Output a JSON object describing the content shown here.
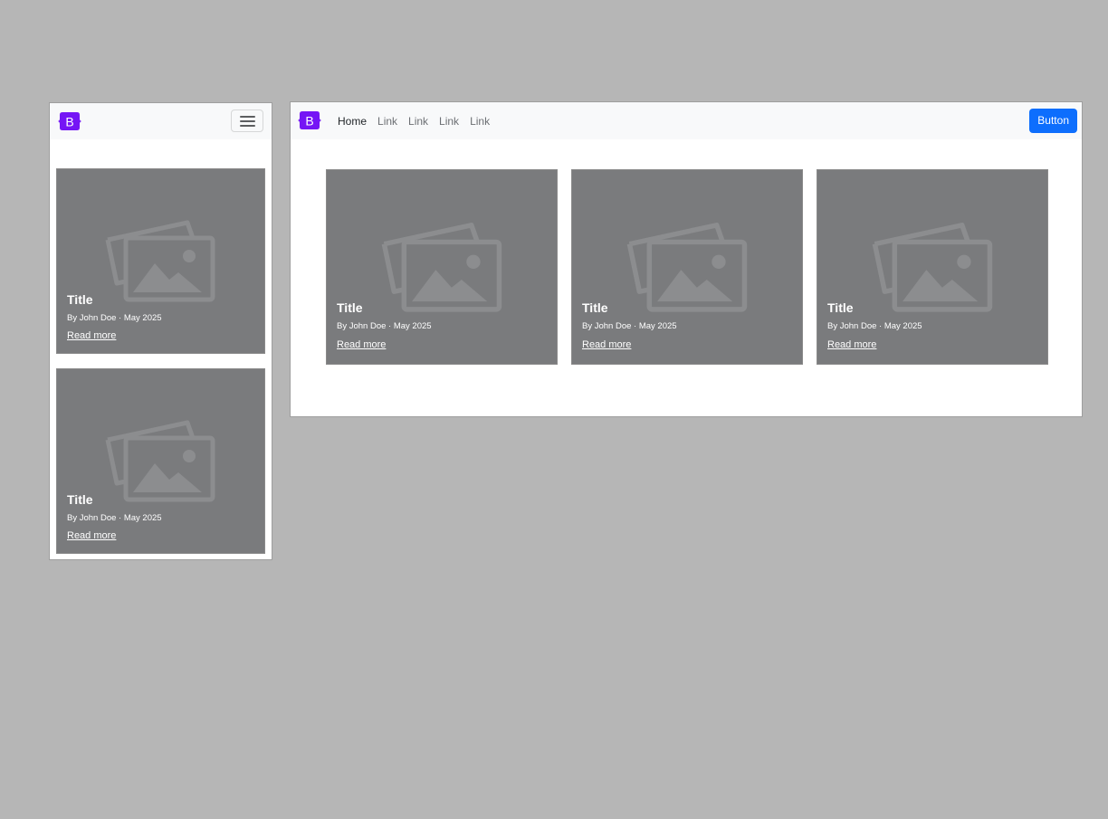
{
  "brand": {
    "logo_letter": "B",
    "logo_color": "#7515f5"
  },
  "navbar_mobile": {
    "toggler_icon": "hamburger-menu-icon"
  },
  "navbar_desktop": {
    "links": [
      "Home",
      "Link",
      "Link",
      "Link",
      "Link"
    ],
    "active_link": "Home",
    "button_label": "Button",
    "button_color": "#0d6efd"
  },
  "card_template": {
    "title": "Title",
    "meta": "By John Doe · May 2025",
    "link_label": "Read more",
    "image_icon": "image-placeholder-icon",
    "background": "#7a7b7d"
  },
  "mobile_cards": [
    {
      "title": "Title",
      "meta": "By John Doe · May 2025",
      "link_label": "Read more"
    },
    {
      "title": "Title",
      "meta": "By John Doe · May 2025",
      "link_label": "Read more"
    }
  ],
  "desktop_cards": [
    {
      "title": "Title",
      "meta": "By John Doe · May 2025",
      "link_label": "Read more"
    },
    {
      "title": "Title",
      "meta": "By John Doe · May 2025",
      "link_label": "Read more"
    },
    {
      "title": "Title",
      "meta": "By John Doe · May 2025",
      "link_label": "Read more"
    }
  ]
}
